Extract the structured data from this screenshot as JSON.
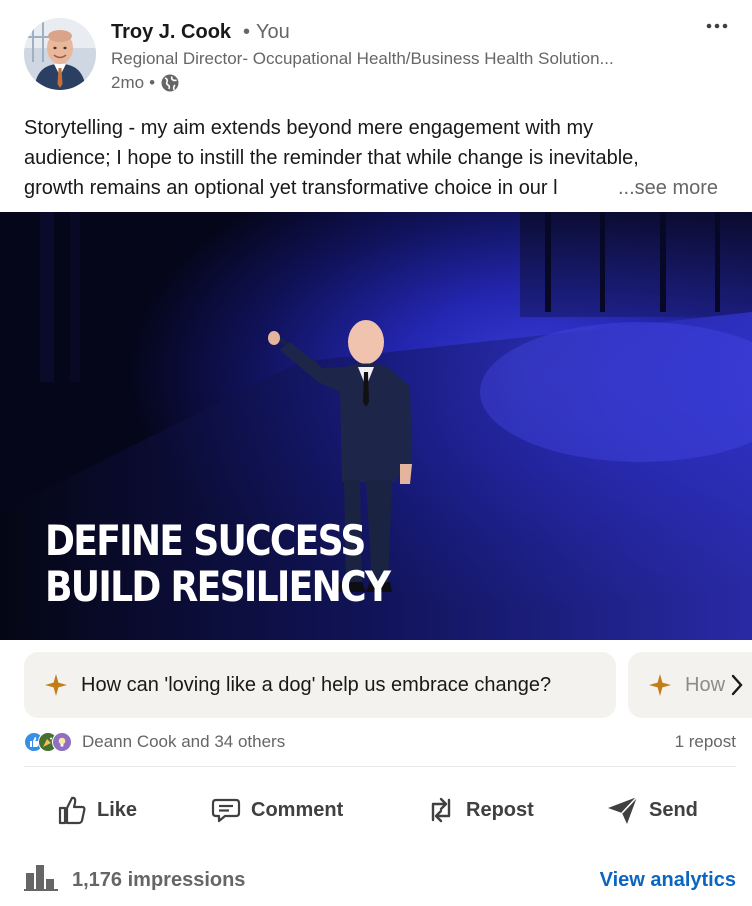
{
  "author": {
    "name": "Troy J. Cook",
    "relation": "You",
    "headline": "Regional Director- Occupational Health/Business Health Solution...",
    "time": "2mo",
    "visibility_icon": "globe-icon"
  },
  "post": {
    "line1": "Storytelling - my aim extends beyond mere engagement with my",
    "line2": "audience; I hope to instill the reminder that while change is inevitable,",
    "line3": "growth remains an optional yet transformative choice in our l",
    "see_more": "...see more"
  },
  "image": {
    "overlay_line1": "DEFINE SUCCESS",
    "overlay_line2": "BUILD RESILIENCY"
  },
  "chips": [
    {
      "label": "How can 'loving like a dog' help us embrace change?",
      "icon": "sparkle-icon"
    },
    {
      "label": "How",
      "icon": "sparkle-icon"
    }
  ],
  "social": {
    "reactors": "Deann Cook and 34 others",
    "reposts": "1 repost"
  },
  "actions": {
    "like": "Like",
    "comment": "Comment",
    "repost": "Repost",
    "send": "Send"
  },
  "analytics": {
    "impressions": "1,176 impressions",
    "view_analytics": "View analytics"
  },
  "colors": {
    "accent": "#0a66c2",
    "sparkle": "#c37d16",
    "chip_bg": "#f4f2ee"
  }
}
